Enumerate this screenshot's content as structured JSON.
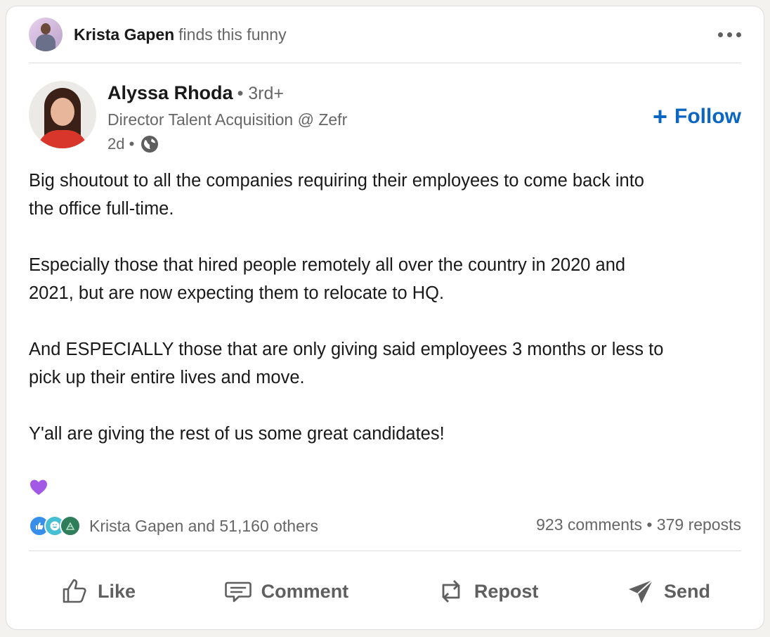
{
  "activity": {
    "name": "Krista Gapen",
    "text": "finds this funny"
  },
  "author": {
    "name": "Alyssa Rhoda",
    "degree": "• 3rd+",
    "headline": "Director Talent Acquisition @ Zefr",
    "time": "2d •"
  },
  "follow_label": "Follow",
  "post": {
    "paragraphs": [
      [
        "Big shoutout to all the companies requiring their employees to come back into",
        "the office full-time."
      ],
      [
        "Especially those that hired people remotely all over the country in 2020 and",
        "2021, but are now expecting them to relocate to HQ."
      ],
      [
        "And ESPECIALLY those that are only giving said employees 3 months or less to",
        "pick up their entire lives and move."
      ],
      [
        "Y'all are giving the rest of us some great candidates!"
      ]
    ],
    "emoji": "purple-heart-icon"
  },
  "social": {
    "reactions_text": "Krista Gapen and 51,160 others",
    "counts_text": "923 comments • 379 reposts",
    "reaction_icons": [
      "like-icon",
      "funny-icon",
      "support-icon"
    ]
  },
  "actions": {
    "like": "Like",
    "comment": "Comment",
    "repost": "Repost",
    "send": "Send"
  },
  "colors": {
    "accent": "#0a66c2",
    "heart": "#a259e6",
    "like_reaction": "#378fe9",
    "funny_reaction": "#44bfd3",
    "support_reaction": "#2e7d5b"
  }
}
